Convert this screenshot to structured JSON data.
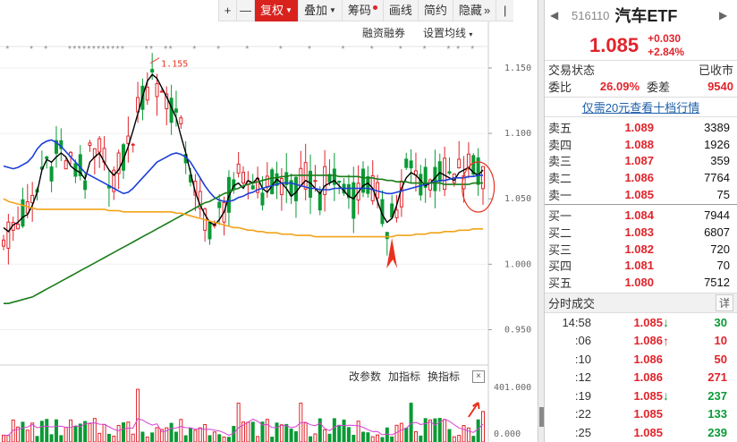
{
  "toolbar": {
    "plus_label": "+",
    "minus_label": "—",
    "fuquan_label": "复权",
    "diejia_label": "叠加",
    "choumai_label": "筹码",
    "huaxian_label": "画线",
    "jianyue_label": "简约",
    "yincang_label": "隐藏",
    "more_label": "»",
    "collapse_label": "|"
  },
  "sub_header": {
    "margin_label": "融资融券",
    "ma_label": "设置均线"
  },
  "vol_header": {
    "edit_params": "改参数",
    "add_indicator": "加指标",
    "swap_indicator": "换指标",
    "close": "×"
  },
  "colors": {
    "up": "#e0242b",
    "down": "#0a9a35",
    "ma_black": "#000000",
    "ma_blue": "#1c3fd8",
    "ma_green": "#1a7d1a",
    "ma_orange": "#f2a31a",
    "vol_ma": "#d640d6",
    "annotation": "#e8311f"
  },
  "chart_data": [
    {
      "type": "candlestick",
      "ylim": [
        0.925,
        1.165
      ],
      "yticks": [
        "1.150",
        "1.100",
        "1.050",
        "1.000",
        "0.950"
      ],
      "max_label": "1.155",
      "max_index": 31,
      "series": [
        {
          "name": "",
          "values": [
            1.028,
            1.025,
            1.03,
            1.032,
            1.036,
            1.038,
            1.045,
            1.055,
            1.072,
            1.08,
            1.078,
            1.082,
            1.085,
            1.082,
            1.075,
            1.072,
            1.07,
            1.065,
            1.078,
            1.082,
            1.085,
            1.078,
            1.072,
            1.068,
            1.072,
            1.08,
            1.09,
            1.102,
            1.115,
            1.128,
            1.14,
            1.145,
            1.142,
            1.135,
            1.128,
            1.12,
            1.112,
            1.098,
            1.085,
            1.07,
            1.055,
            1.045,
            1.038,
            1.032,
            1.03,
            1.034,
            1.04,
            1.052,
            1.06,
            1.062,
            1.058,
            1.064,
            1.062,
            1.066,
            1.058,
            1.055,
            1.06,
            1.065,
            1.062,
            1.058,
            1.052,
            1.055,
            1.06,
            1.064,
            1.062,
            1.058,
            1.054,
            1.06,
            1.062,
            1.064,
            1.06,
            1.056,
            1.052,
            1.05,
            1.055,
            1.06,
            1.062,
            1.058,
            1.048,
            1.038,
            1.032,
            1.035,
            1.045,
            1.058,
            1.066,
            1.07,
            1.068,
            1.064,
            1.06,
            1.062,
            1.066,
            1.07,
            1.068,
            1.066,
            1.064,
            1.07,
            1.072,
            1.074,
            1.07,
            1.068,
            1.072
          ]
        },
        {
          "name": "",
          "values": [
            1.075,
            1.074,
            1.073,
            1.074,
            1.076,
            1.078,
            1.082,
            1.088,
            1.092,
            1.094,
            1.095,
            1.093,
            1.09,
            1.086,
            1.082,
            1.078,
            1.074,
            1.07,
            1.068,
            1.066,
            1.064,
            1.062,
            1.06,
            1.058,
            1.056,
            1.054,
            1.055,
            1.058,
            1.062,
            1.066,
            1.07,
            1.074,
            1.078,
            1.08,
            1.082,
            1.084,
            1.085,
            1.084,
            1.082,
            1.078,
            1.072,
            1.066,
            1.06,
            1.055,
            1.051,
            1.049,
            1.048,
            1.048,
            1.049,
            1.051,
            1.052,
            1.054,
            1.055,
            1.057,
            1.058,
            1.059,
            1.06,
            1.061,
            1.062,
            1.062,
            1.062,
            1.061,
            1.06,
            1.059,
            1.058,
            1.058,
            1.057,
            1.057,
            1.057,
            1.058,
            1.058,
            1.058,
            1.058,
            1.058,
            1.058,
            1.058,
            1.058,
            1.057,
            1.056,
            1.055,
            1.054,
            1.054,
            1.055,
            1.056,
            1.057,
            1.058,
            1.059,
            1.06,
            1.061,
            1.062,
            1.063,
            1.064,
            1.064,
            1.065,
            1.066,
            1.066,
            1.066,
            1.067,
            1.067,
            1.068,
            1.068
          ]
        },
        {
          "name": "",
          "values": [
            0.97,
            0.97,
            0.971,
            0.972,
            0.973,
            0.974,
            0.975,
            0.977,
            0.979,
            0.981,
            0.983,
            0.985,
            0.987,
            0.989,
            0.991,
            0.993,
            0.995,
            0.997,
            0.999,
            1.001,
            1.003,
            1.005,
            1.007,
            1.009,
            1.011,
            1.013,
            1.015,
            1.017,
            1.019,
            1.021,
            1.023,
            1.025,
            1.027,
            1.029,
            1.031,
            1.033,
            1.035,
            1.037,
            1.039,
            1.041,
            1.043,
            1.045,
            1.047,
            1.048,
            1.05,
            1.052,
            1.054,
            1.055,
            1.057,
            1.058,
            1.06,
            1.061,
            1.062,
            1.063,
            1.064,
            1.065,
            1.066,
            1.066,
            1.067,
            1.067,
            1.068,
            1.068,
            1.068,
            1.068,
            1.068,
            1.068,
            1.068,
            1.068,
            1.068,
            1.068,
            1.067,
            1.067,
            1.067,
            1.067,
            1.067,
            1.066,
            1.066,
            1.066,
            1.065,
            1.065,
            1.064,
            1.064,
            1.063,
            1.063,
            1.063,
            1.062,
            1.062,
            1.062,
            1.062,
            1.062,
            1.062,
            1.062,
            1.061,
            1.061,
            1.061,
            1.061,
            1.061,
            1.061,
            1.062,
            1.062,
            1.062
          ]
        },
        {
          "name": "",
          "values": [
            1.05,
            1.048,
            1.047,
            1.046,
            1.045,
            1.044,
            1.043,
            1.042,
            1.042,
            1.042,
            1.042,
            1.042,
            1.042,
            1.042,
            1.042,
            1.042,
            1.042,
            1.042,
            1.042,
            1.042,
            1.042,
            1.042,
            1.041,
            1.041,
            1.041,
            1.04,
            1.04,
            1.04,
            1.04,
            1.04,
            1.04,
            1.04,
            1.04,
            1.04,
            1.04,
            1.04,
            1.039,
            1.039,
            1.038,
            1.037,
            1.036,
            1.035,
            1.034,
            1.033,
            1.032,
            1.031,
            1.03,
            1.029,
            1.028,
            1.028,
            1.027,
            1.026,
            1.026,
            1.025,
            1.025,
            1.024,
            1.024,
            1.024,
            1.023,
            1.023,
            1.023,
            1.022,
            1.022,
            1.022,
            1.022,
            1.021,
            1.021,
            1.021,
            1.021,
            1.021,
            1.021,
            1.021,
            1.021,
            1.021,
            1.021,
            1.021,
            1.021,
            1.021,
            1.021,
            1.021,
            1.021,
            1.021,
            1.022,
            1.022,
            1.022,
            1.022,
            1.023,
            1.023,
            1.023,
            1.024,
            1.024,
            1.024,
            1.025,
            1.025,
            1.025,
            1.026,
            1.026,
            1.026,
            1.027,
            1.027,
            1.027
          ]
        }
      ]
    },
    {
      "type": "bar",
      "ylim": [
        0,
        401
      ],
      "yticks": [
        "401.000",
        "0.000"
      ]
    }
  ],
  "quote": {
    "code": "516110",
    "name": "汽车ETF",
    "price": "1.085",
    "change": "+0.030",
    "change_pct": "+2.84%",
    "status_label": "交易状态",
    "status_value": "已收市",
    "weibi_label": "委比",
    "weibi_value": "26.09%",
    "weicha_label": "委差",
    "weicha_value": "9540",
    "link_text": "仅需20元查看十档行情",
    "asks": [
      {
        "label": "卖五",
        "price": "1.089",
        "vol": "3389"
      },
      {
        "label": "卖四",
        "price": "1.088",
        "vol": "1926"
      },
      {
        "label": "卖三",
        "price": "1.087",
        "vol": "359"
      },
      {
        "label": "卖二",
        "price": "1.086",
        "vol": "7764"
      },
      {
        "label": "卖一",
        "price": "1.085",
        "vol": "75"
      }
    ],
    "bids": [
      {
        "label": "买一",
        "price": "1.084",
        "vol": "7944"
      },
      {
        "label": "买二",
        "price": "1.083",
        "vol": "6807"
      },
      {
        "label": "买三",
        "price": "1.082",
        "vol": "720"
      },
      {
        "label": "买四",
        "price": "1.081",
        "vol": "70"
      },
      {
        "label": "买五",
        "price": "1.080",
        "vol": "7512"
      }
    ],
    "trades_title": "分时成交",
    "trades_detail": "详",
    "trades": [
      {
        "time": "14:58",
        "price": "1.085",
        "arrow": "↓",
        "dir": "down",
        "vol": "30"
      },
      {
        "time": ":06",
        "price": "1.086",
        "arrow": "↑",
        "dir": "up",
        "vol": "10"
      },
      {
        "time": ":10",
        "price": "1.086",
        "arrow": "",
        "dir": "up",
        "vol": "50"
      },
      {
        "time": ":12",
        "price": "1.086",
        "arrow": "",
        "dir": "up",
        "vol": "271"
      },
      {
        "time": ":19",
        "price": "1.085",
        "arrow": "↓",
        "dir": "down",
        "vol": "237"
      },
      {
        "time": ":22",
        "price": "1.085",
        "arrow": "",
        "dir": "down",
        "vol": "133"
      },
      {
        "time": ":25",
        "price": "1.085",
        "arrow": "",
        "dir": "down",
        "vol": "239"
      }
    ]
  }
}
